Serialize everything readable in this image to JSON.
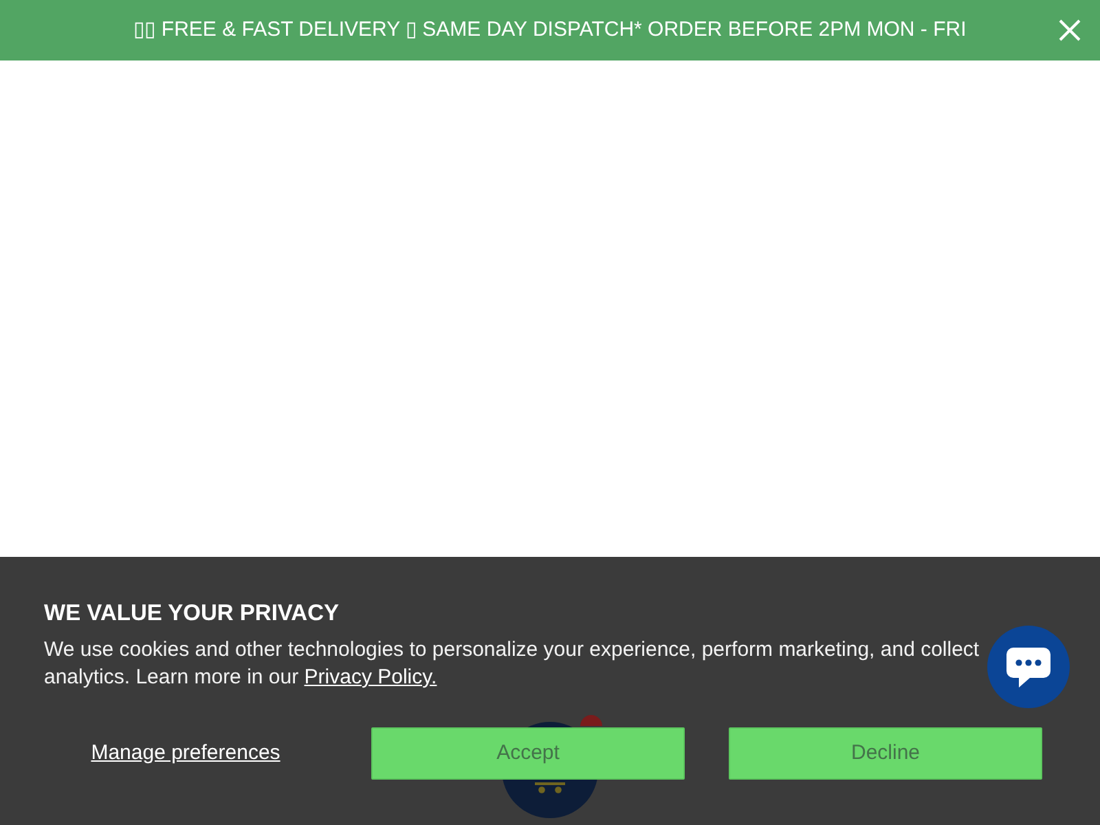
{
  "announcement": {
    "text": "▯▯ FREE & FAST DELIVERY ▯ SAME DAY DISPATCH* ORDER BEFORE 2PM MON - FRI"
  },
  "cookie_banner": {
    "title": "WE VALUE YOUR PRIVACY",
    "body": "We use cookies and other technologies to personalize your experience, perform marketing, and collect analytics. Learn more in our",
    "link": "Privacy Policy.",
    "manage_link": "Manage preferences",
    "buttons": [
      {
        "label": "Accept"
      },
      {
        "label": "Decline"
      }
    ]
  }
}
